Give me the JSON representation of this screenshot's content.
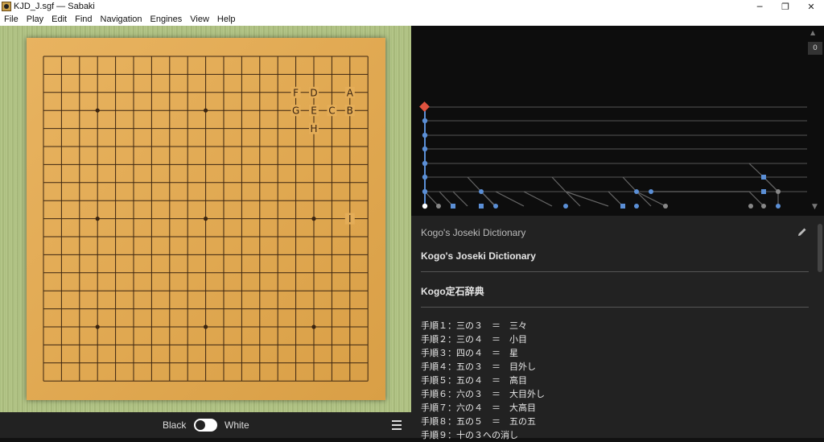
{
  "window": {
    "title": "KJD_J.sgf — Sabaki",
    "min_glyph": "─",
    "max_glyph": "❐",
    "close_glyph": "✕"
  },
  "menu": [
    "File",
    "Play",
    "Edit",
    "Find",
    "Navigation",
    "Engines",
    "View",
    "Help"
  ],
  "board": {
    "size": 19,
    "labels": [
      {
        "text": "F",
        "col": 14,
        "row": 2
      },
      {
        "text": "D",
        "col": 15,
        "row": 2
      },
      {
        "text": "A",
        "col": 17,
        "row": 2
      },
      {
        "text": "G",
        "col": 14,
        "row": 3
      },
      {
        "text": "E",
        "col": 15,
        "row": 3
      },
      {
        "text": "C",
        "col": 16,
        "row": 3
      },
      {
        "text": "B",
        "col": 17,
        "row": 3
      },
      {
        "text": "H",
        "col": 15,
        "row": 4
      },
      {
        "text": "I",
        "col": 17,
        "row": 9
      }
    ]
  },
  "player_bar": {
    "black": "Black",
    "white": "White"
  },
  "game_tree": {
    "move_count": "0",
    "up_arrow": "▲",
    "down_arrow": "▼"
  },
  "comment": {
    "header": "Kogo's Joseki Dictionary",
    "title_en": "Kogo's Joseki Dictionary",
    "title_jp": "Kogo定石辞典",
    "lines": [
      "手順１：三の３　＝　三々",
      "手順２：三の４　＝　小目",
      "手順３：四の４　＝　星",
      "手順４：五の３　＝　目外し",
      "手順５：五の４　＝　高目",
      "手順６：六の３　＝　大目外し",
      "手順７：六の４　＝　大高目",
      "手順８：五の５　＝　五の五",
      "手順９：十の３への消し"
    ]
  },
  "colors": {
    "tree_active": "#5b8fd6",
    "tree_root": "#e0533f",
    "tree_muted": "#888888"
  }
}
